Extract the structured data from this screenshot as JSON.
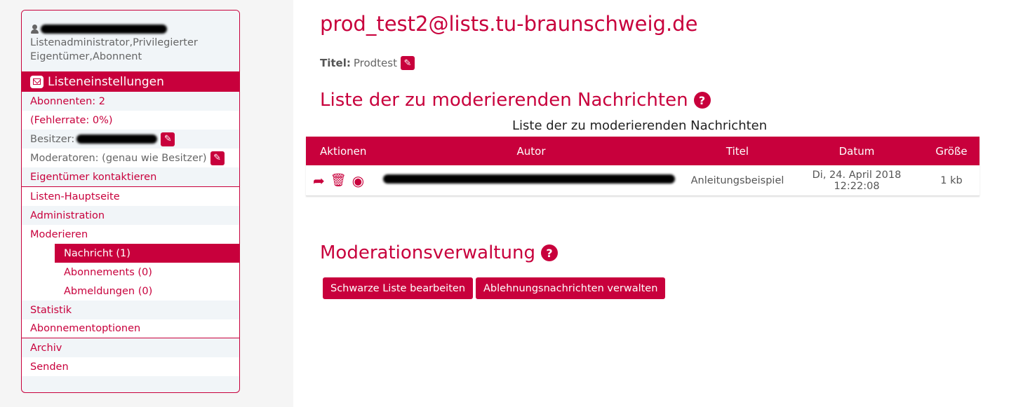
{
  "sidebar": {
    "user": {
      "name_redacted": true,
      "roles": "Listenadministrator,Privilegierter Eigentümer,Abonnent"
    },
    "section_title": "Listeneinstellungen",
    "info": {
      "subscribers": "Abonnenten: 2",
      "error_rate": "(Fehlerrate: 0%)",
      "owner_label": "Besitzer:",
      "moderators": "Moderatoren: (genau wie Besitzer)",
      "contact_owner": "Eigentümer kontaktieren"
    },
    "nav": {
      "main_page": "Listen-Hauptseite",
      "administration": "Administration",
      "moderate": "Moderieren",
      "moderate_sub": [
        {
          "label": "Nachricht (1)",
          "active": true
        },
        {
          "label": "Abonnements (0)",
          "active": false
        },
        {
          "label": "Abmeldungen (0)",
          "active": false
        }
      ],
      "statistics": "Statistik",
      "subscription_options": "Abonnementoptionen",
      "archive": "Archiv",
      "send": "Senden"
    }
  },
  "main": {
    "list_address": "prod_test2@lists.tu-braunschweig.de",
    "title_label": "Titel:",
    "title_value": "Prodtest",
    "moderation_list": {
      "heading": "Liste der zu moderierenden Nachrichten",
      "caption": "Liste der zu moderierenden Nachrichten",
      "columns": [
        "Aktionen",
        "Autor",
        "Titel",
        "Datum",
        "Größe"
      ],
      "rows": [
        {
          "actions": [
            "forward-icon",
            "trash-icon",
            "eye-icon"
          ],
          "author_redacted": true,
          "title": "Anleitungsbeispiel",
          "date": "Di, 24. April 2018 12:22:08",
          "size": "1 kb"
        }
      ]
    },
    "moderation_admin": {
      "heading": "Moderationsverwaltung",
      "buttons": {
        "blacklist": "Schwarze Liste bearbeiten",
        "rejection_messages": "Ablehnungsnachrichten verwalten"
      }
    }
  },
  "colors": {
    "accent": "#c8003c",
    "sidebar_bg": "#f1f5f8",
    "page_left_bg": "#f5f5f5"
  }
}
